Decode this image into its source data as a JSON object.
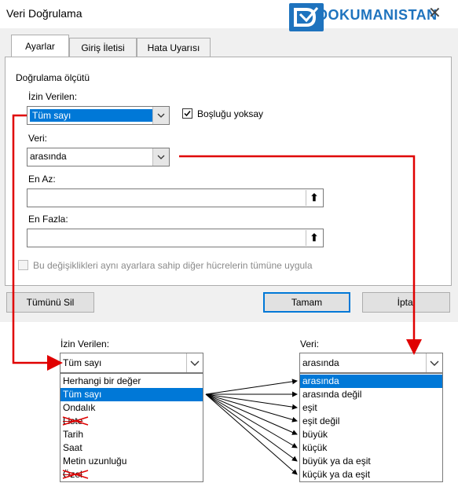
{
  "dialog": {
    "title": "Veri Doğrulama",
    "logo": "DOKUMANISTAN",
    "close_glyph": "✕",
    "tabs": [
      "Ayarlar",
      "Giriş İletisi",
      "Hata Uyarısı"
    ],
    "group_label": "Doğrulama ölçütü",
    "allow_label": "İzin Verilen:",
    "allow_value": "Tüm sayı",
    "ignore_blank_label": "Boşluğu yoksay",
    "data_label": "Veri:",
    "data_value": "arasında",
    "min_label": "En Az:",
    "max_label": "En Fazla:",
    "apply_all_label": "Bu değişiklikleri aynı ayarlara sahip diğer hücrelerin tümüne uygula",
    "clear_all_button": "Tümünü Sil",
    "ok_button": "Tamam",
    "cancel_button": "İptal"
  },
  "lower": {
    "allow_label": "İzin Verilen:",
    "allow_value": "Tüm sayı",
    "allow_options": [
      "Herhangi bir değer",
      "Tüm sayı",
      "Ondalık",
      "Liste",
      "Tarih",
      "Saat",
      "Metin uzunluğu",
      "Özel"
    ],
    "data_label": "Veri:",
    "data_value": "arasında",
    "data_options": [
      "arasında",
      "arasında değil",
      "eşit",
      "eşit değil",
      "büyük",
      "küçük",
      "büyük ya da eşit",
      "küçük ya da eşit"
    ]
  },
  "colors": {
    "accent": "#0078d7",
    "arrow_red": "#e00000",
    "logo_blue": "#1e73be"
  }
}
